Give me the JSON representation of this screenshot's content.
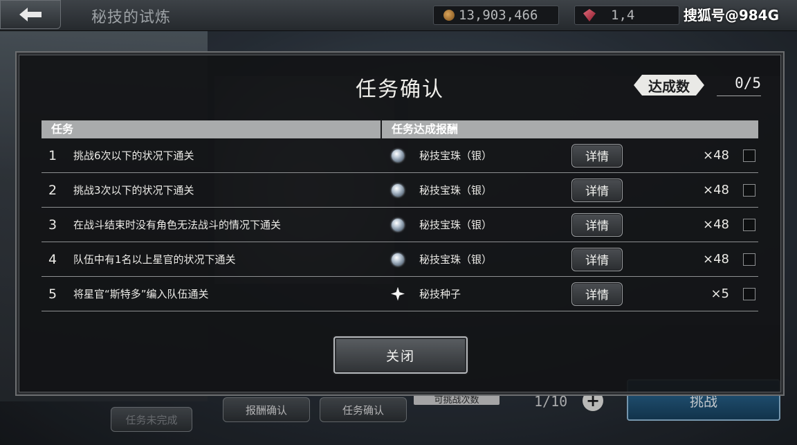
{
  "header": {
    "title": "秘技的试炼",
    "gold": "13,903,466",
    "gems": "1,4",
    "watermark": "搜狐号@984G"
  },
  "modal": {
    "title": "任务确认",
    "achieve_label": "达成数",
    "achieve_count": "0/5",
    "col_task": "任务",
    "col_reward": "任务达成报酬",
    "detail_label": "详情",
    "close_label": "关闭",
    "rows": [
      {
        "num": "1",
        "task": "挑战6次以下的状况下通关",
        "reward_icon": "silver-orb-icon",
        "reward": "秘技宝珠（银）",
        "qty": "×48"
      },
      {
        "num": "2",
        "task": "挑战3次以下的状况下通关",
        "reward_icon": "silver-orb-icon",
        "reward": "秘技宝珠（银）",
        "qty": "×48"
      },
      {
        "num": "3",
        "task": "在战斗结束时没有角色无法战斗的情况下通关",
        "reward_icon": "silver-orb-icon",
        "reward": "秘技宝珠（银）",
        "qty": "×48"
      },
      {
        "num": "4",
        "task": "队伍中有1名以上星官的状况下通关",
        "reward_icon": "silver-orb-icon",
        "reward": "秘技宝珠（银）",
        "qty": "×48"
      },
      {
        "num": "5",
        "task": "将星官“斯特多”编入队伍通关",
        "reward_icon": "seed-icon",
        "reward": "秘技种子",
        "qty": "×5"
      }
    ]
  },
  "bottom": {
    "reward_confirm": "报酬确认",
    "task_confirm": "任务确认",
    "task_incomplete": "任务未完成",
    "challenge_label": "可挑战次数",
    "challenge_count": "1/10",
    "start_label": "挑战"
  },
  "colors": {
    "header_bar": "#a9abac",
    "modal_bg": "#121315",
    "start_button": "#2e6f9d"
  }
}
